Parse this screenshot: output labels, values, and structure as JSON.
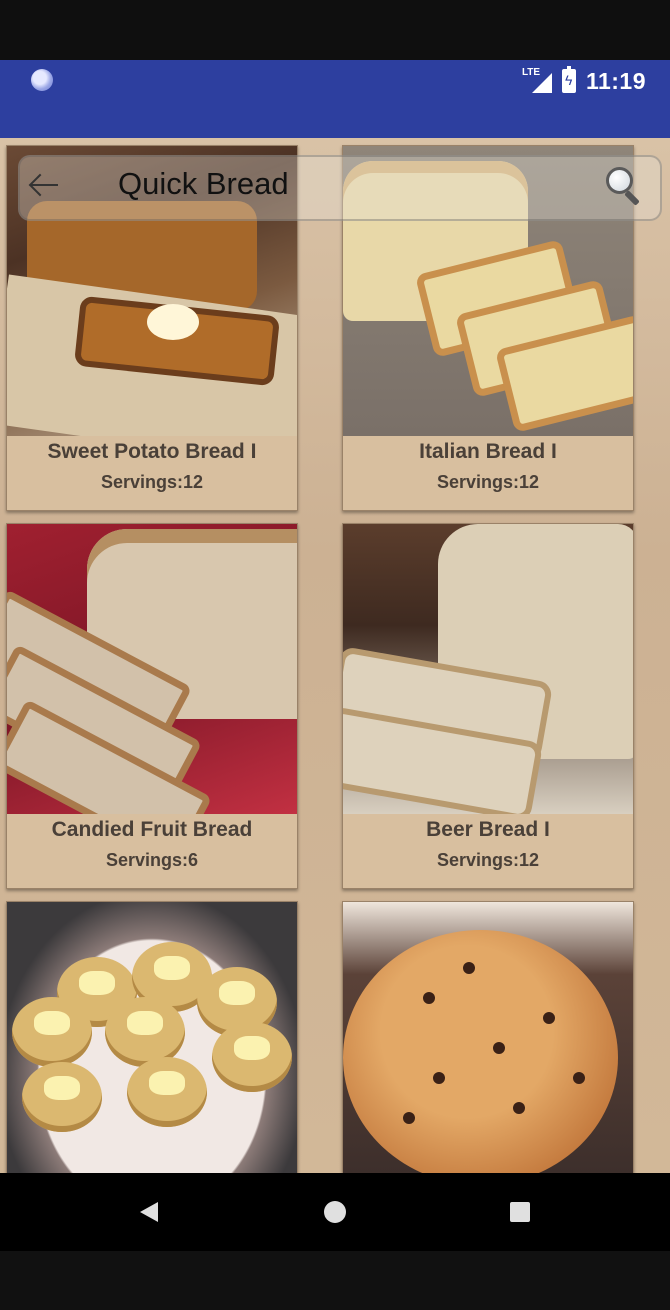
{
  "status_bar": {
    "network": "LTE",
    "time": "11:19",
    "icons": [
      "notification-icon",
      "signal-icon",
      "battery-charging-icon"
    ]
  },
  "app_bar": {
    "title": "Quick Bread",
    "back_icon": "back-arrow-icon",
    "search_icon": "search-icon"
  },
  "recipes": [
    {
      "name": "Sweet Potato Bread I",
      "servings": "Servings:12"
    },
    {
      "name": "Italian Bread I",
      "servings": "Servings:12"
    },
    {
      "name": "Candied Fruit Bread",
      "servings": "Servings:6"
    },
    {
      "name": "Beer Bread I",
      "servings": "Servings:12"
    },
    {
      "name": "",
      "servings": ""
    },
    {
      "name": "",
      "servings": ""
    }
  ],
  "nav_bar": {
    "buttons": [
      "back-icon",
      "home-icon",
      "recents-icon"
    ]
  },
  "colors": {
    "status_bar": "#2d3f9f",
    "background": "#d2b898",
    "card": "#d8bf9f",
    "text": "#4a4038"
  }
}
